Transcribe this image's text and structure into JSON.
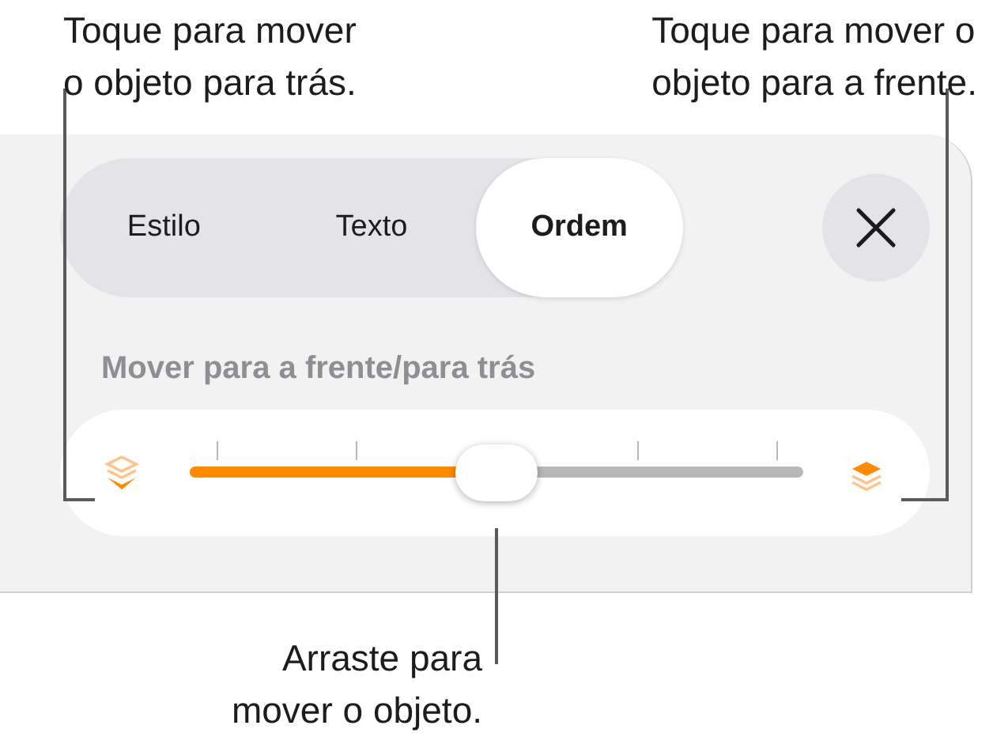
{
  "callouts": [
    {
      "kind": "top-left",
      "text": "Toque para mover\no objeto para trás."
    },
    {
      "kind": "top-right",
      "text": "Toque para mover o\nobjeto para a frente."
    },
    {
      "kind": "bottom",
      "text": "Arraste para\nmover o objeto."
    }
  ],
  "tabs": [
    {
      "label": "Estilo",
      "selected": false
    },
    {
      "label": "Texto",
      "selected": false
    },
    {
      "label": "Ordem",
      "selected": true
    }
  ],
  "section_label": "Mover para a frente/para trás",
  "slider": {
    "level": 0.5
  }
}
